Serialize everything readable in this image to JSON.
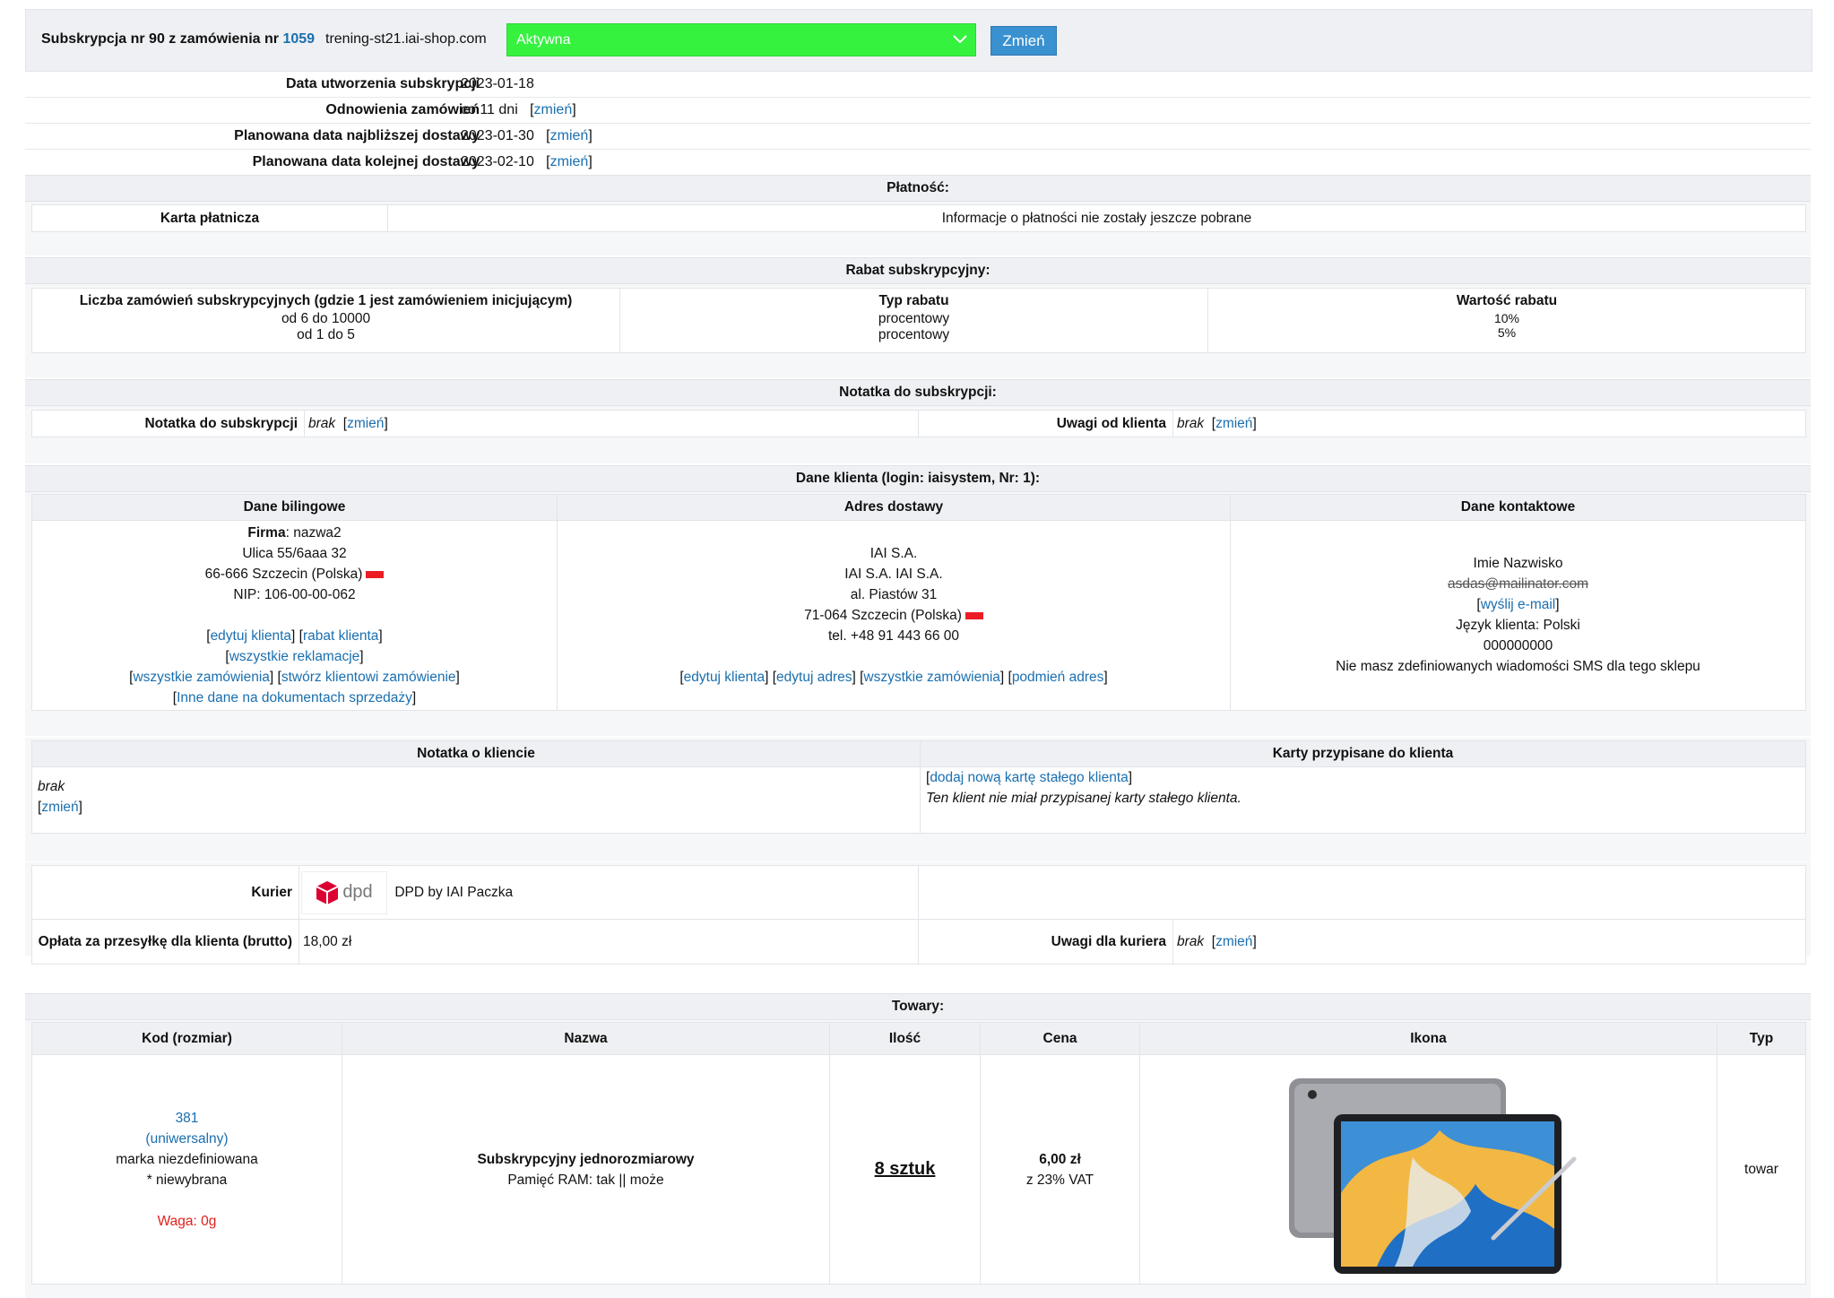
{
  "header": {
    "title_prefix": "Subskrypcja nr 90 z zamówienia nr",
    "order_number": "1059",
    "domain": "trening-st21.iai-shop.com",
    "status_value": "Aktywna",
    "change_button": "Zmień",
    "status_color": "#35f23f"
  },
  "details": [
    {
      "label": "Data utworzenia subskrypcji",
      "value": "2023-01-18",
      "link": ""
    },
    {
      "label": "Odnowienia zamówień",
      "value": "co 11 dni",
      "link": "zmień"
    },
    {
      "label": "Planowana data najbliższej dostawy",
      "value": "2023-01-30",
      "link": "zmień"
    },
    {
      "label": "Planowana data kolejnej dostawy",
      "value": "2023-02-10",
      "link": "zmień"
    }
  ],
  "payment": {
    "section_title": "Płatność:",
    "label": "Karta płatnicza",
    "value": "Informacje o płatności nie zostały jeszcze pobrane"
  },
  "discount": {
    "section_title": "Rabat subskrypcyjny:",
    "col1_header": "Liczba zamówień subskrypcyjnych (gdzie 1 jest zamówieniem inicjującym)",
    "col2_header": "Typ rabatu",
    "col3_header": "Wartość rabatu",
    "ranges": [
      "od 6 do 10000",
      "od 1 do 5"
    ],
    "types": [
      "procentowy",
      "procentowy"
    ],
    "values": [
      "10%",
      "5%"
    ]
  },
  "note": {
    "section_title": "Notatka do subskrypcji:",
    "label": "Notatka do subskrypcji",
    "value": "brak",
    "link": "zmień",
    "client_label": "Uwagi od klienta",
    "client_value": "brak",
    "client_link": "zmień"
  },
  "client": {
    "section_title": "Dane klienta (login: iaisystem, Nr: 1):",
    "billing_header": "Dane bilingowe",
    "delivery_header": "Adres dostawy",
    "contact_header": "Dane kontaktowe",
    "billing": {
      "company_label": "Firma",
      "company": "nazwa2",
      "street": "Ulica 55/6aaa 32",
      "city": "66-666 Szczecin (Polska)",
      "nip": "NIP: 106-00-00-062",
      "links": {
        "edit_client": "edytuj klienta",
        "client_discount": "rabat klienta",
        "all_complaints": "wszystkie reklamacje",
        "all_orders": "wszystkie zamówienia",
        "create_order": "stwórz klientowi zamówienie",
        "other_data": "Inne dane na dokumentach sprzedaży"
      }
    },
    "delivery": {
      "line1": "IAI S.A.",
      "line2": "IAI S.A. IAI S.A.",
      "street": "al. Piastów 31",
      "city": "71-064 Szczecin (Polska)",
      "phone": "tel. +48 91 443 66 00",
      "links": {
        "edit_client": "edytuj klienta",
        "edit_address": "edytuj adres",
        "all_orders": "wszystkie zamówienia",
        "replace_address": "podmień adres"
      }
    },
    "contact": {
      "name": "Imie Nazwisko",
      "email": "asdas@mailinator.com",
      "send_email": "wyślij e-mail",
      "language": "Język klienta: Polski",
      "phone": "000000000",
      "sms_info": "Nie masz zdefiniowanych wiadomości SMS dla tego sklepu"
    }
  },
  "client_note": {
    "header": "Notatka o kliencie",
    "value": "brak",
    "link": "zmień",
    "cards_header": "Karty przypisane do klienta",
    "add_card": "dodaj nową kartę stałego klienta",
    "no_card": "Ten klient nie miał przypisanej karty stałego klienta."
  },
  "shipping": {
    "courier_label": "Kurier",
    "courier_logo_text": "dpd",
    "courier_name": "DPD by IAI Paczka",
    "fee_label": "Opłata za przesyłkę dla klienta (brutto)",
    "fee_value": "18,00 zł",
    "notes_label": "Uwagi dla kuriera",
    "notes_value": "brak",
    "notes_link": "zmień",
    "logo_color": "#dc0032"
  },
  "products": {
    "section_title": "Towary:",
    "columns": [
      "Kod (rozmiar)",
      "Nazwa",
      "Ilość",
      "Cena",
      "Ikona",
      "Typ"
    ],
    "rows": [
      {
        "code": "381",
        "size": "(uniwersalny)",
        "brand": "marka niezdefiniowana",
        "variant": "* niewybrana",
        "weight": "Waga: 0g",
        "name": "Subskrypcyjny jednorozmiarowy",
        "params": "Pamięć RAM: tak || może",
        "quantity": "8 sztuk",
        "price": "6,00 zł",
        "vat": "z 23% VAT",
        "type": "towar"
      }
    ]
  }
}
